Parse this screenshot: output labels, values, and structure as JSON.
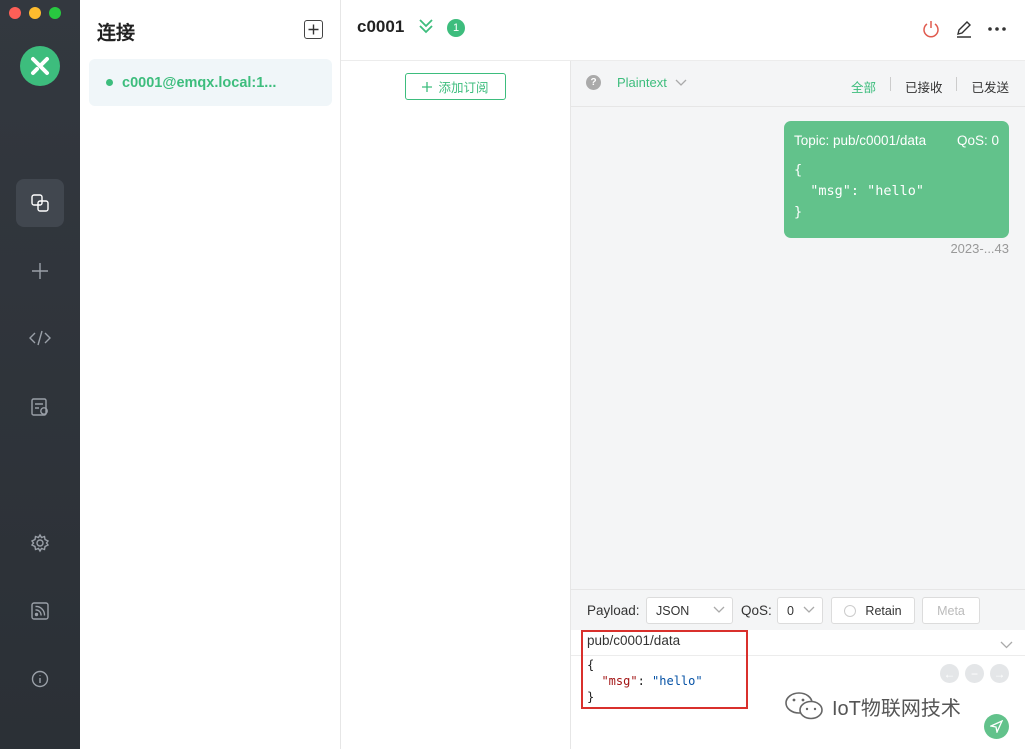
{
  "sidebar": {
    "logo_icon": "mqttx-logo-icon",
    "items": [
      {
        "name": "connections",
        "icon": "connections-icon"
      },
      {
        "name": "new",
        "icon": "plus-icon"
      },
      {
        "name": "script",
        "icon": "code-icon"
      },
      {
        "name": "log",
        "icon": "log-icon"
      },
      {
        "name": "settings",
        "icon": "gear-icon"
      },
      {
        "name": "feed",
        "icon": "rss-icon"
      },
      {
        "name": "about",
        "icon": "info-icon"
      }
    ]
  },
  "connections": {
    "title": "连接",
    "items": [
      {
        "label": "c0001@emqx.local:1...",
        "status": "connected"
      }
    ]
  },
  "header": {
    "title": "c0001",
    "badge": "1"
  },
  "subscriptions": {
    "add_label": "添加订阅"
  },
  "messages": {
    "format": "Plaintext",
    "filters": [
      "全部",
      "已接收",
      "已发送"
    ],
    "items": [
      {
        "topic": "Topic: pub/c0001/data",
        "qos": "QoS: 0",
        "payload": "{\n  \"msg\": \"hello\"\n}",
        "time": "2023-...43"
      }
    ]
  },
  "publish": {
    "payload_label": "Payload:",
    "payload_format": "JSON",
    "qos_label": "QoS:",
    "qos_value": "0",
    "retain_label": "Retain",
    "meta_label": "Meta",
    "topic": "pub/c0001/data",
    "payload_lines": {
      "open": "{",
      "key": "\"msg\"",
      "colon": ": ",
      "value": "\"hello\"",
      "close": "}"
    }
  },
  "watermark": "IoT物联网技术",
  "colors": {
    "accent": "#3dbd7d",
    "bubble": "#62c28b",
    "highlight": "#d9302c"
  }
}
